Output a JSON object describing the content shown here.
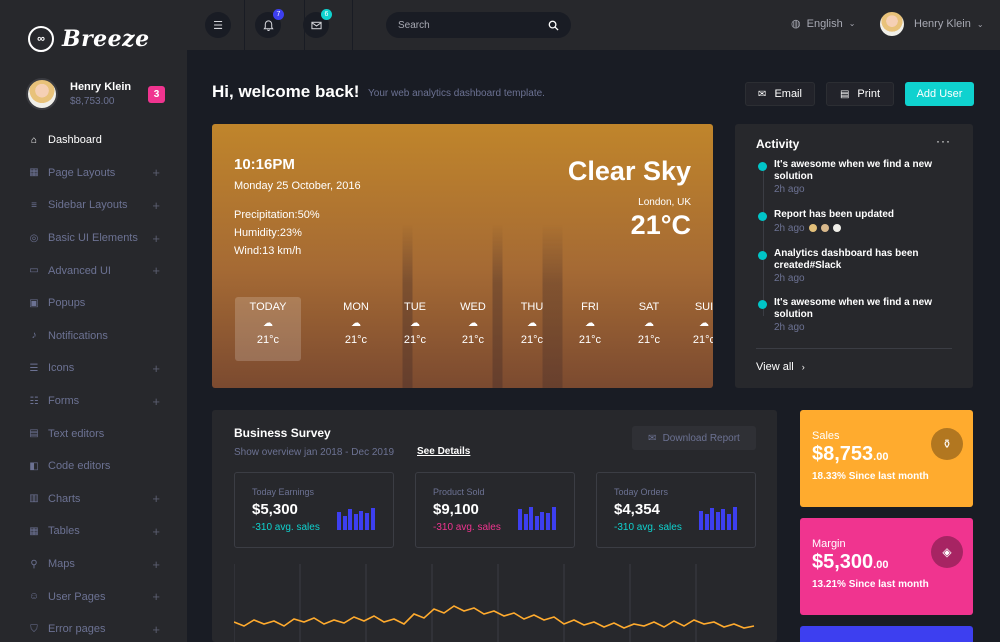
{
  "brand": {
    "name": "Breeze",
    "mark": "∞"
  },
  "profile": {
    "name": "Henry Klein",
    "amount": "$8,753.00",
    "badge": "3"
  },
  "nav": [
    {
      "label": "Dashboard",
      "icon": "home-icon",
      "glyph": "⌂",
      "expandable": false,
      "active": true
    },
    {
      "label": "Page Layouts",
      "icon": "grid-icon",
      "glyph": "▦",
      "expandable": true
    },
    {
      "label": "Sidebar Layouts",
      "icon": "list-icon",
      "glyph": "≡",
      "expandable": true
    },
    {
      "label": "Basic UI Elements",
      "icon": "target-icon",
      "glyph": "◎",
      "expandable": true
    },
    {
      "label": "Advanced UI",
      "icon": "monitor-icon",
      "glyph": "▭",
      "expandable": true
    },
    {
      "label": "Popups",
      "icon": "popup-icon",
      "glyph": "▣",
      "expandable": false
    },
    {
      "label": "Notifications",
      "icon": "bell-icon",
      "glyph": "♪",
      "expandable": false
    },
    {
      "label": "Icons",
      "icon": "layers-icon",
      "glyph": "☰",
      "expandable": true
    },
    {
      "label": "Forms",
      "icon": "form-icon",
      "glyph": "☷",
      "expandable": true
    },
    {
      "label": "Text editors",
      "icon": "file-icon",
      "glyph": "▤",
      "expandable": false
    },
    {
      "label": "Code editors",
      "icon": "code-icon",
      "glyph": "◧",
      "expandable": false
    },
    {
      "label": "Charts",
      "icon": "chart-icon",
      "glyph": "▥",
      "expandable": true
    },
    {
      "label": "Tables",
      "icon": "table-icon",
      "glyph": "▦",
      "expandable": true
    },
    {
      "label": "Maps",
      "icon": "map-pin-icon",
      "glyph": "⚲",
      "expandable": true
    },
    {
      "label": "User Pages",
      "icon": "user-icon",
      "glyph": "☺",
      "expandable": true
    },
    {
      "label": "Error pages",
      "icon": "shield-icon",
      "glyph": "⛉",
      "expandable": true
    }
  ],
  "topbar": {
    "notifications_count": "7",
    "messages_count": "6",
    "search_placeholder": "Search",
    "language": "English",
    "user_name": "Henry Klein"
  },
  "header": {
    "title": "Hi, welcome back!",
    "subtitle": "Your web analytics dashboard template.",
    "email_label": "Email",
    "print_label": "Print",
    "add_user_label": "Add User"
  },
  "weather": {
    "time": "10:16PM",
    "date": "Monday 25 October, 2016",
    "precipitation": "Precipitation:50%",
    "humidity": "Humidity:23%",
    "wind": "Wind:13 km/h",
    "condition": "Clear Sky",
    "location": "London, UK",
    "temperature": "21°C",
    "forecast": [
      {
        "day": "TODAY",
        "temp": "21°c"
      },
      {
        "day": "MON",
        "temp": "21°c"
      },
      {
        "day": "TUE",
        "temp": "21°c"
      },
      {
        "day": "WED",
        "temp": "21°c"
      },
      {
        "day": "THU",
        "temp": "21°c"
      },
      {
        "day": "FRI",
        "temp": "21°c"
      },
      {
        "day": "SAT",
        "temp": "21°c"
      },
      {
        "day": "SUI",
        "temp": "21°c"
      }
    ]
  },
  "activity": {
    "title": "Activity",
    "items": [
      {
        "text": "It's awesome when we find a new solution",
        "time": "2h ago"
      },
      {
        "text": "Report has been updated",
        "time": "2h ago"
      },
      {
        "text": "Analytics dashboard has been created#Slack",
        "time": "2h ago"
      },
      {
        "text": "It's awesome when we find a new solution",
        "time": "2h ago"
      }
    ],
    "view_all": "View all"
  },
  "survey": {
    "title": "Business Survey",
    "subtitle": "Show overview jan 2018 - Dec 2019",
    "details_link": "See Details",
    "download_label": "Download Report",
    "stats": [
      {
        "label": "Today Earnings",
        "value": "$5,300",
        "delta": "-310 avg. sales",
        "delta_color": "#0fd2cf",
        "bars": [
          0.7,
          0.55,
          0.8,
          0.6,
          0.75,
          0.65,
          0.85
        ]
      },
      {
        "label": "Product Sold",
        "value": "$9,100",
        "delta": "-310 avg. sales",
        "delta_color": "#f0348f",
        "bars": [
          0.8,
          0.6,
          0.9,
          0.55,
          0.7,
          0.65,
          0.9
        ]
      },
      {
        "label": "Today Orders",
        "value": "$4,354",
        "delta": "-310 avg. sales",
        "delta_color": "#0fd2cf",
        "bars": [
          0.75,
          0.6,
          0.85,
          0.7,
          0.8,
          0.6,
          0.9
        ]
      }
    ]
  },
  "side_cards": [
    {
      "label": "Sales",
      "value": "$8,753",
      "cents": ".00",
      "note": "18.33% Since last month",
      "color": "#ffab2e",
      "icon": "basket-icon",
      "glyph": "⚱"
    },
    {
      "label": "Margin",
      "value": "$5,300",
      "cents": ".00",
      "note": "13.21% Since last month",
      "color": "#f0348f",
      "icon": "cube-icon",
      "glyph": "◈"
    }
  ],
  "colors": {
    "accent": "#0fd2cf",
    "bars": "#3d3ff0",
    "line": "#ffab2e",
    "pink": "#f0348f"
  }
}
